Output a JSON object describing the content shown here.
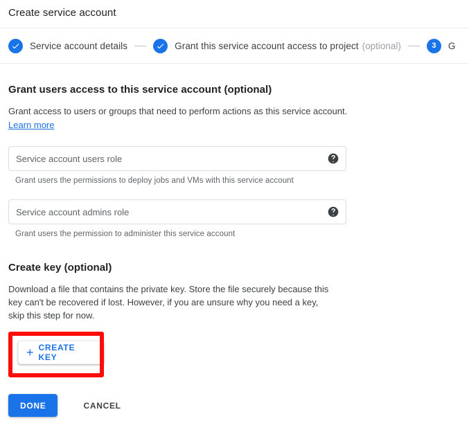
{
  "header": {
    "title": "Create service account"
  },
  "stepper": {
    "steps": [
      {
        "marker": "check-icon",
        "label": "Service account details",
        "optional": ""
      },
      {
        "marker": "check-icon",
        "label": "Grant this service account access to project",
        "optional": "(optional)"
      },
      {
        "marker": "3",
        "label": "G",
        "optional": ""
      }
    ],
    "connector": "—"
  },
  "grant_users": {
    "heading": "Grant users access to this service account (optional)",
    "description": "Grant access to users or groups that need to perform actions as this service account.",
    "learn_more": "Learn more",
    "fields": [
      {
        "placeholder": "Service account users role",
        "value": "",
        "hint": "Grant users the permissions to deploy jobs and VMs with this service account",
        "help_icon": "help-circle-icon"
      },
      {
        "placeholder": "Service account admins role",
        "value": "",
        "hint": "Grant users the permission to administer this service account",
        "help_icon": "help-circle-icon"
      }
    ]
  },
  "create_key": {
    "heading": "Create key (optional)",
    "description": "Download a file that contains the private key. Store the file securely because this key can't be recovered if lost. However, if you are unsure why you need a key, skip this step for now.",
    "button_label": "CREATE KEY",
    "button_icon": "plus-icon"
  },
  "footer": {
    "done_label": "DONE",
    "cancel_label": "CANCEL"
  },
  "colors": {
    "accent_blue": "#1a73e8",
    "highlight_red": "#fc0d09",
    "text_primary": "#202124",
    "text_secondary": "#5f6368"
  }
}
